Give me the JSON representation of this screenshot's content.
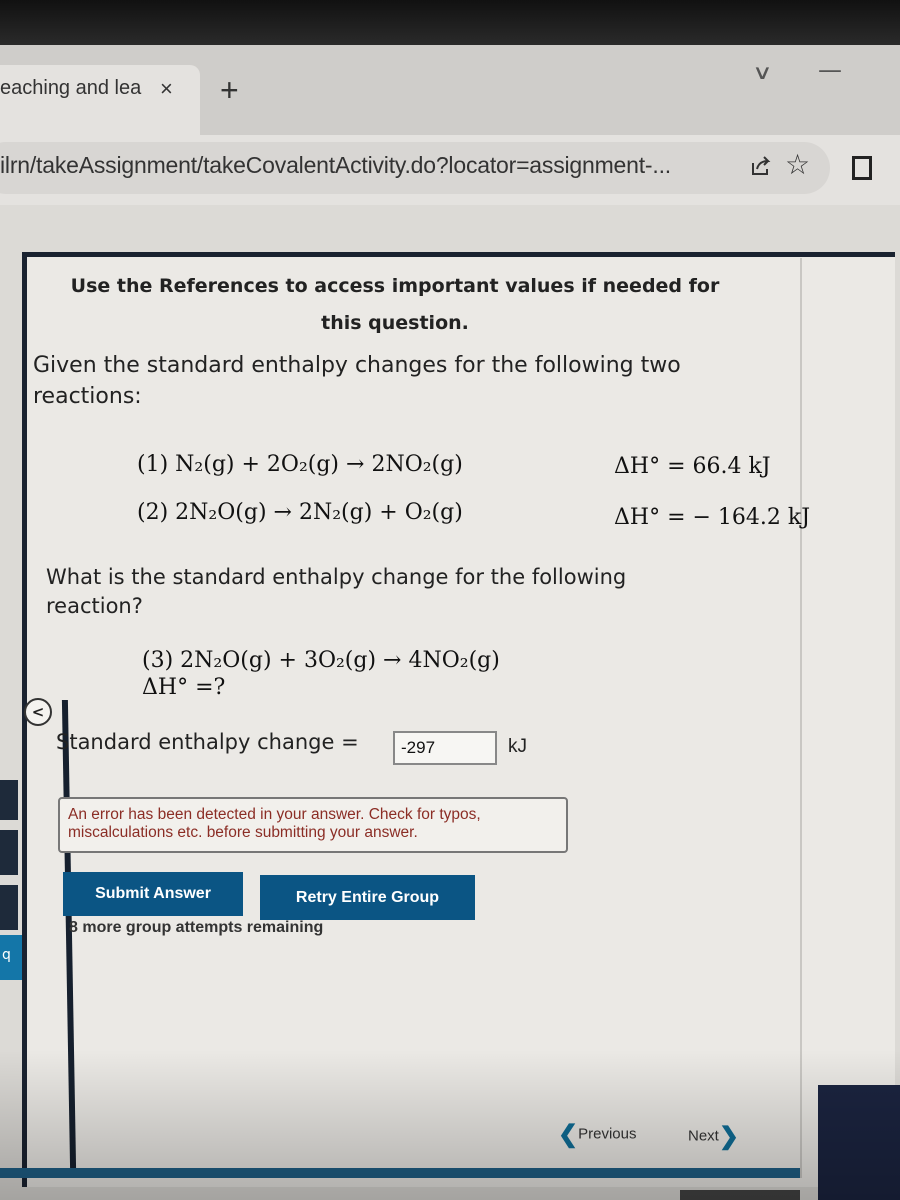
{
  "browser": {
    "tab_title": "eaching and lea",
    "tab_close_icon": "×",
    "new_tab_icon": "+",
    "url": "ilrn/takeAssignment/takeCovalentActivity.do?locator=assignment-...",
    "star_icon": "☆",
    "chevron_icon": "∨",
    "minimize_icon": "—"
  },
  "sidebar": {
    "collapse_icon": "<",
    "blue_tab_glyph": "q"
  },
  "content": {
    "references": "Use the References to access important values if needed for this question.",
    "intro": "Given the standard enthalpy changes for the following two reactions:",
    "reactions": [
      {
        "num": "(1)",
        "lhs": "N₂(g) + 2O₂(g)",
        "arrow": "→",
        "rhs": "2NO₂(g)",
        "dh_label": "ΔH° =",
        "dh_value": "66.4 kJ"
      },
      {
        "num": "(2)",
        "lhs": "2N₂O(g)",
        "arrow": "→",
        "rhs": "2N₂(g) + O₂(g)",
        "dh_label": "ΔH° =",
        "dh_value": "− 164.2 kJ"
      }
    ],
    "question": "What is the standard enthalpy change for the following reaction?",
    "target_reaction": {
      "num": "(3)",
      "lhs": "2N₂O(g) + 3O₂(g)",
      "arrow": "→",
      "rhs": "4NO₂(g)",
      "dh_label": "ΔH° =?"
    },
    "answer_label": "Standard enthalpy change =",
    "answer_value": "-297",
    "answer_unit": "kJ",
    "error_message": "An error has been detected in your answer. Check for typos, miscalculations etc. before submitting your answer.",
    "submit_label": "Submit Answer",
    "retry_label": "Retry Entire Group",
    "attempts_text": "8 more group attempts remaining"
  },
  "navigation": {
    "previous_label": "Previous",
    "next_label": "Next",
    "prev_icon": "❮",
    "next_icon": "❯"
  },
  "colors": {
    "button_bg": "#0b5584",
    "error_text": "#8b2d25",
    "nav_chevron": "#0f6d96"
  }
}
